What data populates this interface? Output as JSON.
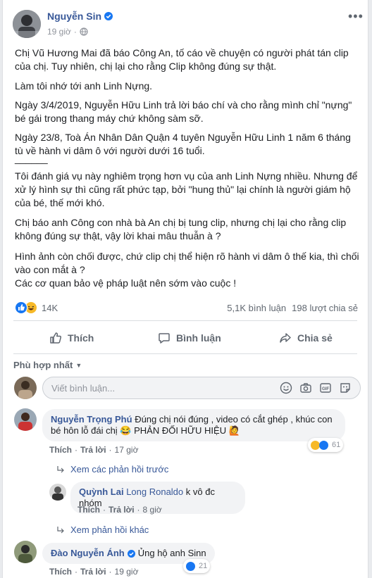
{
  "post": {
    "author": "Nguyễn Sin",
    "time": "19 giờ",
    "paragraphs": [
      "Chị Vũ Hương Mai đã báo Công An, tố cáo về chuyện có người phát tán clip của chị. Tuy nhiên, chị lại cho rằng Clip không đúng sự thật.",
      "Làm tôi nhớ tới anh Linh Nựng.",
      "Ngày 3/4/2019, Nguyễn Hữu Linh trả lời báo chí và cho rằng mình chỉ \"nựng\" bé gái trong thang máy chứ không sàm sỡ.",
      "Ngày 23/8, Toà Án Nhân Dân Quận 4 tuyên Nguyễn Hữu Linh 1 năm 6 tháng tù về hành vi dâm ô với người dưới 16 tuổi.",
      "______",
      "Tôi đánh giá vụ này nghiêm trọng hơn vụ của anh Linh Nựng nhiều. Nhưng để xử lý hình sự thì cũng rất phức tạp, bởi \"hung thủ\" lại chính là người giám hộ của bé, thế mới khó.",
      "Chị báo anh Công con nhà bà An chị bị tung clip, nhưng chị lại cho rằng clip không đúng sự thật, vậy lời khai mâu thuẫn à ?",
      "Hình ảnh còn chối được, chứ clip chị thể hiện rõ hành vi dâm ô thế kia, thì chối vào con mắt à ?",
      "Các cơ quan bảo vệ pháp luật nên sớm vào cuộc !"
    ],
    "reactions_count": "14K",
    "comments_count": "5,1K bình luận",
    "shares_count": "198 lượt chia sẻ"
  },
  "actions": {
    "like": "Thích",
    "comment": "Bình luận",
    "share": "Chia sẻ"
  },
  "sort_label": "Phù hợp nhất",
  "comment_input": {
    "placeholder": "Viết bình luận..."
  },
  "comments": [
    {
      "name": "Nguyễn Trọng Phú",
      "text": "Đúng chị nói đúng , video có cắt ghép , khúc con bé hôn lỗ đái chị 😂 PHẢN ĐỐI HỮU HIỆU 🙋",
      "like": "Thích",
      "reply": "Trả lời",
      "time": "17 giờ",
      "reactions": "61",
      "view_prev": "Xem các phản hồi trước",
      "reply_item": {
        "name": "Quỳnh Lai",
        "mention": "Long Ronaldo",
        "text": "k vô đc nhóm",
        "like": "Thích",
        "reply": "Trả lời",
        "time": "8 giờ"
      },
      "view_more": "Xem phản hồi khác"
    },
    {
      "name": "Đào Nguyễn Ánh",
      "text": "Ủng hộ anh Sinn",
      "like": "Thích",
      "reply": "Trả lời",
      "time": "19 giờ",
      "reactions": "21"
    }
  ],
  "colors": {
    "link": "#385898",
    "verified": "#1877f2",
    "like_blue": "#1877f2",
    "haha_yellow": "#f7b928"
  }
}
